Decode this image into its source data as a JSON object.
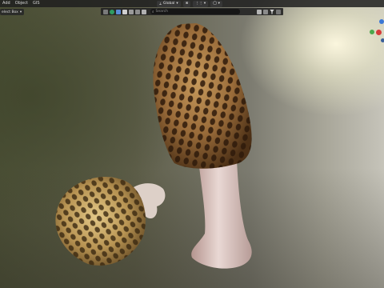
{
  "menubar": {
    "items": [
      "Add",
      "Object",
      "GIS"
    ]
  },
  "header": {
    "select_mode": "elect Box",
    "transform_orientation": "Global"
  },
  "outliner": {
    "search_placeholder": "Search"
  },
  "colors": {
    "menubar_bg": "#1e1e1e",
    "toolbar_bg": "#232323",
    "x_axis": "#d63a3a",
    "y_axis": "#4ca84c",
    "z_axis": "#3b78d6"
  },
  "icons": [
    "snap-icon",
    "proportional-edit-icon",
    "filter-icon",
    "gizmo-x-axis",
    "gizmo-y-axis",
    "gizmo-z-axis"
  ]
}
